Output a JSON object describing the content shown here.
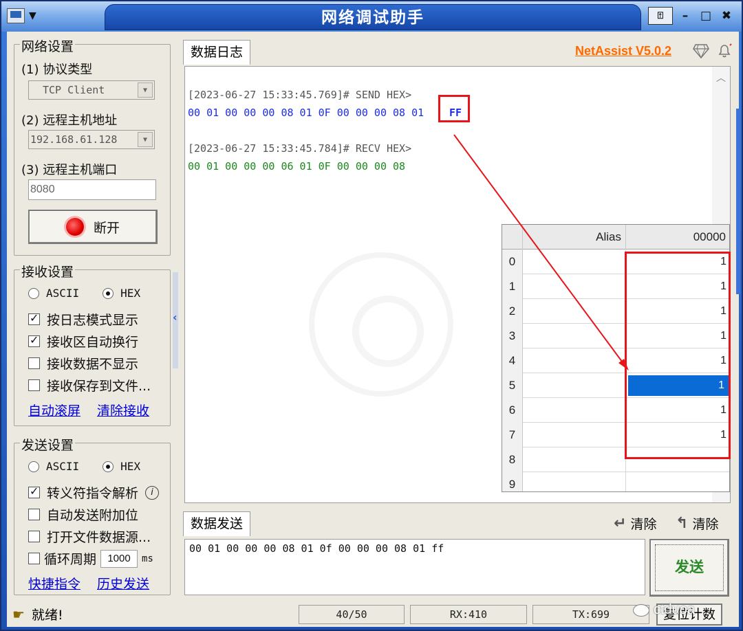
{
  "window": {
    "title": "网络调试助手",
    "controls": {
      "pin": "⍐",
      "minimize": "–",
      "maximize": "□",
      "close": "✖"
    }
  },
  "network": {
    "group_title": "网络设置",
    "protocol_label": "(1) 协议类型",
    "protocol_value": "TCP Client",
    "host_label": "(2) 远程主机地址",
    "host_value": "192.168.61.128",
    "port_label": "(3) 远程主机端口",
    "port_value": "8080",
    "connect_button": "断开"
  },
  "receive": {
    "group_title": "接收设置",
    "ascii": "ASCII",
    "hex": "HEX",
    "options": [
      "按日志模式显示",
      "接收区自动换行",
      "接收数据不显示",
      "接收保存到文件..."
    ],
    "auto_scroll": "自动滚屏",
    "clear": "清除接收"
  },
  "send": {
    "group_title": "发送设置",
    "ascii": "ASCII",
    "hex": "HEX",
    "options": [
      "转义符指令解析",
      "自动发送附加位",
      "打开文件数据源..."
    ],
    "loop_label": "循环周期",
    "loop_value": "1000",
    "loop_unit": "ms",
    "shortcut": "快捷指令",
    "history": "历史发送"
  },
  "log": {
    "tab": "数据日志",
    "brand": "NetAssist V5.0.2",
    "entries": [
      {
        "meta": "[2023-06-27 15:33:45.769]# SEND HEX>",
        "data": "00 01 00 00 00 08 01 0F 00 00 00 08 01",
        "tail": "FF"
      },
      {
        "meta": "[2023-06-27 15:33:45.784]# RECV HEX>",
        "data": "00 01 00 00 00 06 01 0F 00 00 00 08"
      }
    ]
  },
  "grid": {
    "headers": {
      "alias": "Alias",
      "value": "00000"
    },
    "rows": [
      {
        "index": "0",
        "value": "1"
      },
      {
        "index": "1",
        "value": "1"
      },
      {
        "index": "2",
        "value": "1"
      },
      {
        "index": "3",
        "value": "1"
      },
      {
        "index": "4",
        "value": "1"
      },
      {
        "index": "5",
        "value": "1"
      },
      {
        "index": "6",
        "value": "1"
      },
      {
        "index": "7",
        "value": "1"
      },
      {
        "index": "8",
        "value": ""
      },
      {
        "index": "9",
        "value": ""
      }
    ]
  },
  "sendarea": {
    "tab": "数据发送",
    "clear_label": "清除",
    "clear2_label": "清除",
    "content": "00 01 00 00 00 08 01 0f 00 00 00 08 01 ff",
    "send_button": "发送"
  },
  "status": {
    "ready": "就绪!",
    "count": "40/50",
    "rx": "RX:410",
    "tx": "TX:699",
    "reset": "复位计数",
    "watermark": "ctduoa"
  },
  "colors": {
    "send": "#1a2ce8",
    "recv": "#1b8a1b",
    "highlight": "#e8141a",
    "brand": "#ff6a00"
  }
}
